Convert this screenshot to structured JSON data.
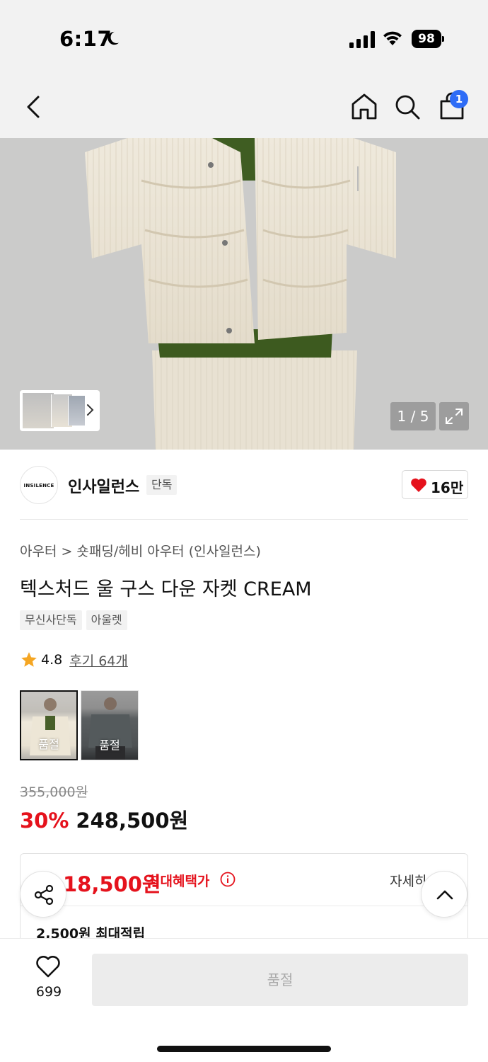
{
  "status_bar": {
    "time": "6:17",
    "battery": "98"
  },
  "nav": {
    "cart_count": "1"
  },
  "gallery": {
    "counter": "1 / 5"
  },
  "brand": {
    "logo_text": "INSILENCE",
    "name": "인사일런스",
    "tag": "단독",
    "likes": "16만"
  },
  "product": {
    "breadcrumb": [
      "아우터",
      "숏패딩/헤비 아우터 (인사일런스)"
    ],
    "breadcrumb_sep": ">",
    "title": "텍스처드 울 구스 다운 자켓 CREAM",
    "tags": [
      "무신사단독",
      "아울렛"
    ],
    "rating": "4.8",
    "reviews": "후기 64개",
    "swatches": [
      {
        "label": "품절",
        "selected": true
      },
      {
        "label": "품절",
        "selected": false
      }
    ],
    "original_price": "355,000원",
    "discount": "30%",
    "sale_price": "248,500원"
  },
  "benefit": {
    "price": "18,500원",
    "label": "최대혜택가",
    "detail": "자세히",
    "points": "2,500원 최대적립"
  },
  "bottom": {
    "wish_count": "699",
    "cta": "품절"
  },
  "colors": {
    "accent_red": "#e5121c",
    "badge_blue": "#2e6cf6"
  }
}
